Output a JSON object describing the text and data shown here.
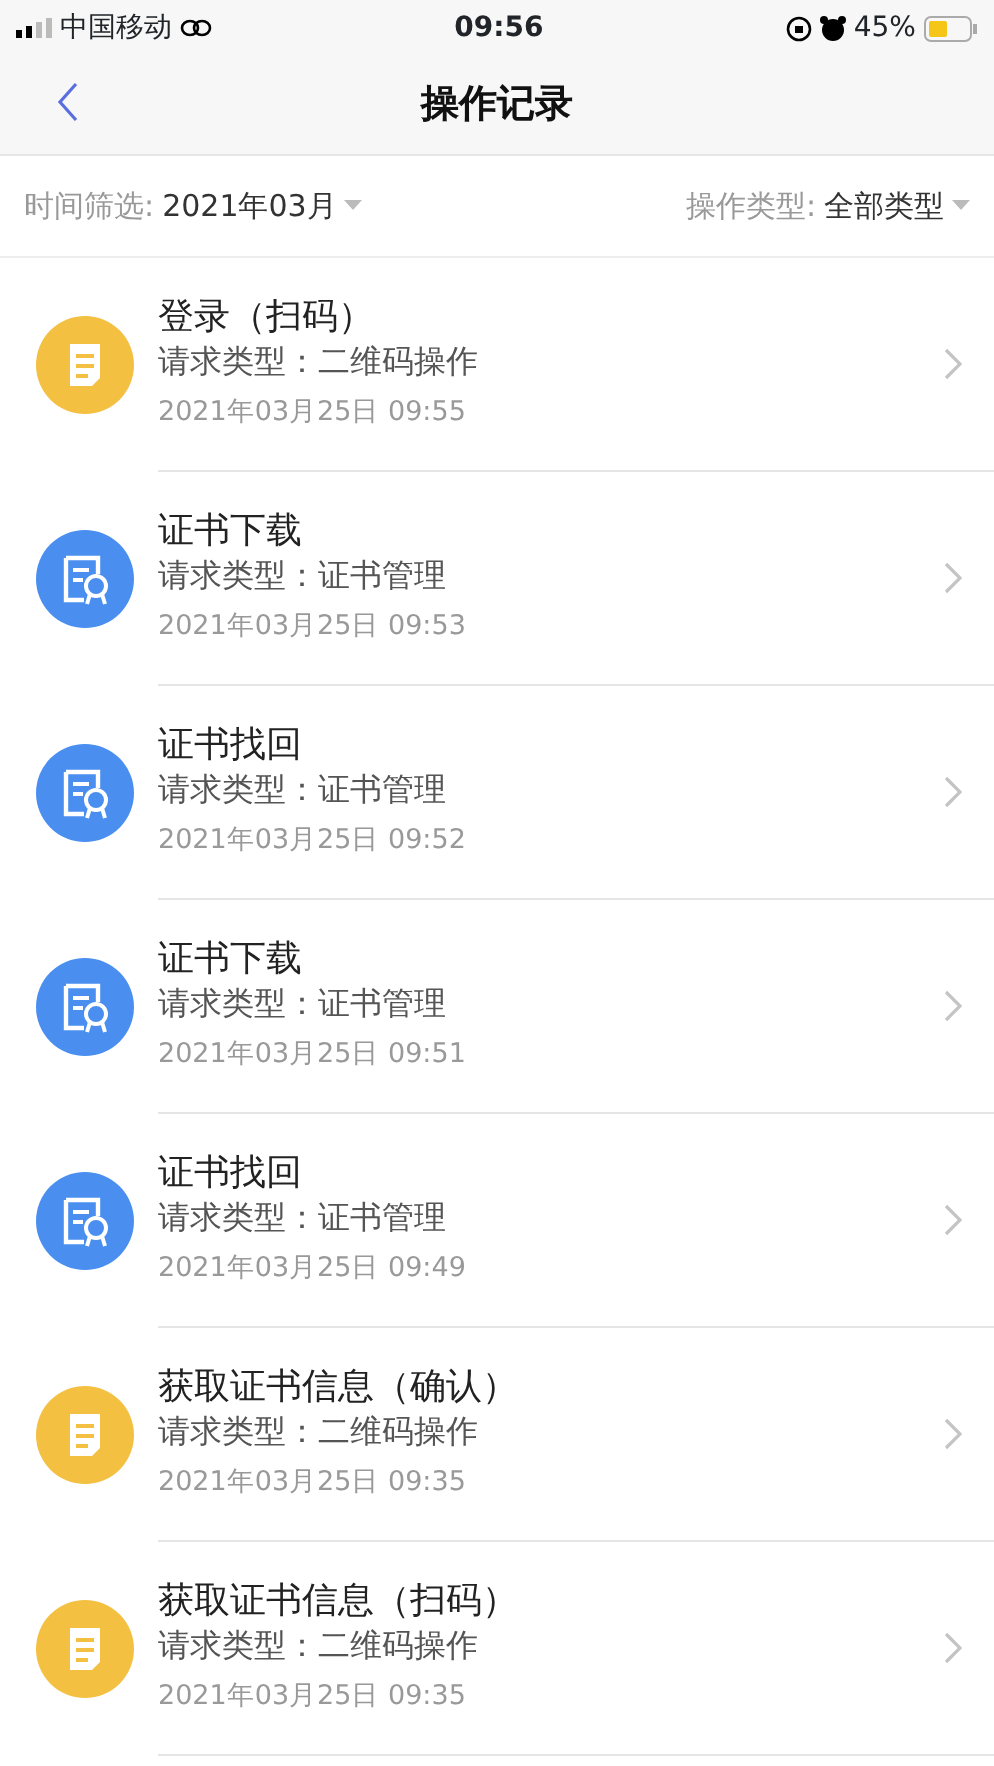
{
  "status_bar": {
    "carrier": "中国移动",
    "time": "09:56",
    "battery": "45%"
  },
  "nav": {
    "title": "操作记录"
  },
  "filters": [
    {
      "label": "时间筛选:",
      "value": "2021年03月"
    },
    {
      "label": "操作类型:",
      "value": "全部类型"
    }
  ],
  "records": [
    {
      "kind": "document",
      "title": "登录（扫码）",
      "type": "请求类型：二维码操作",
      "time": "2021年03月25日 09:55"
    },
    {
      "kind": "certificate",
      "title": "证书下载",
      "type": "请求类型：证书管理",
      "time": "2021年03月25日 09:53"
    },
    {
      "kind": "certificate",
      "title": "证书找回",
      "type": "请求类型：证书管理",
      "time": "2021年03月25日 09:52"
    },
    {
      "kind": "certificate",
      "title": "证书下载",
      "type": "请求类型：证书管理",
      "time": "2021年03月25日 09:51"
    },
    {
      "kind": "certificate",
      "title": "证书找回",
      "type": "请求类型：证书管理",
      "time": "2021年03月25日 09:49"
    },
    {
      "kind": "document",
      "title": "获取证书信息（确认）",
      "type": "请求类型：二维码操作",
      "time": "2021年03月25日 09:35"
    },
    {
      "kind": "document",
      "title": "获取证书信息（扫码）",
      "type": "请求类型：二维码操作",
      "time": "2021年03月25日 09:35"
    }
  ]
}
